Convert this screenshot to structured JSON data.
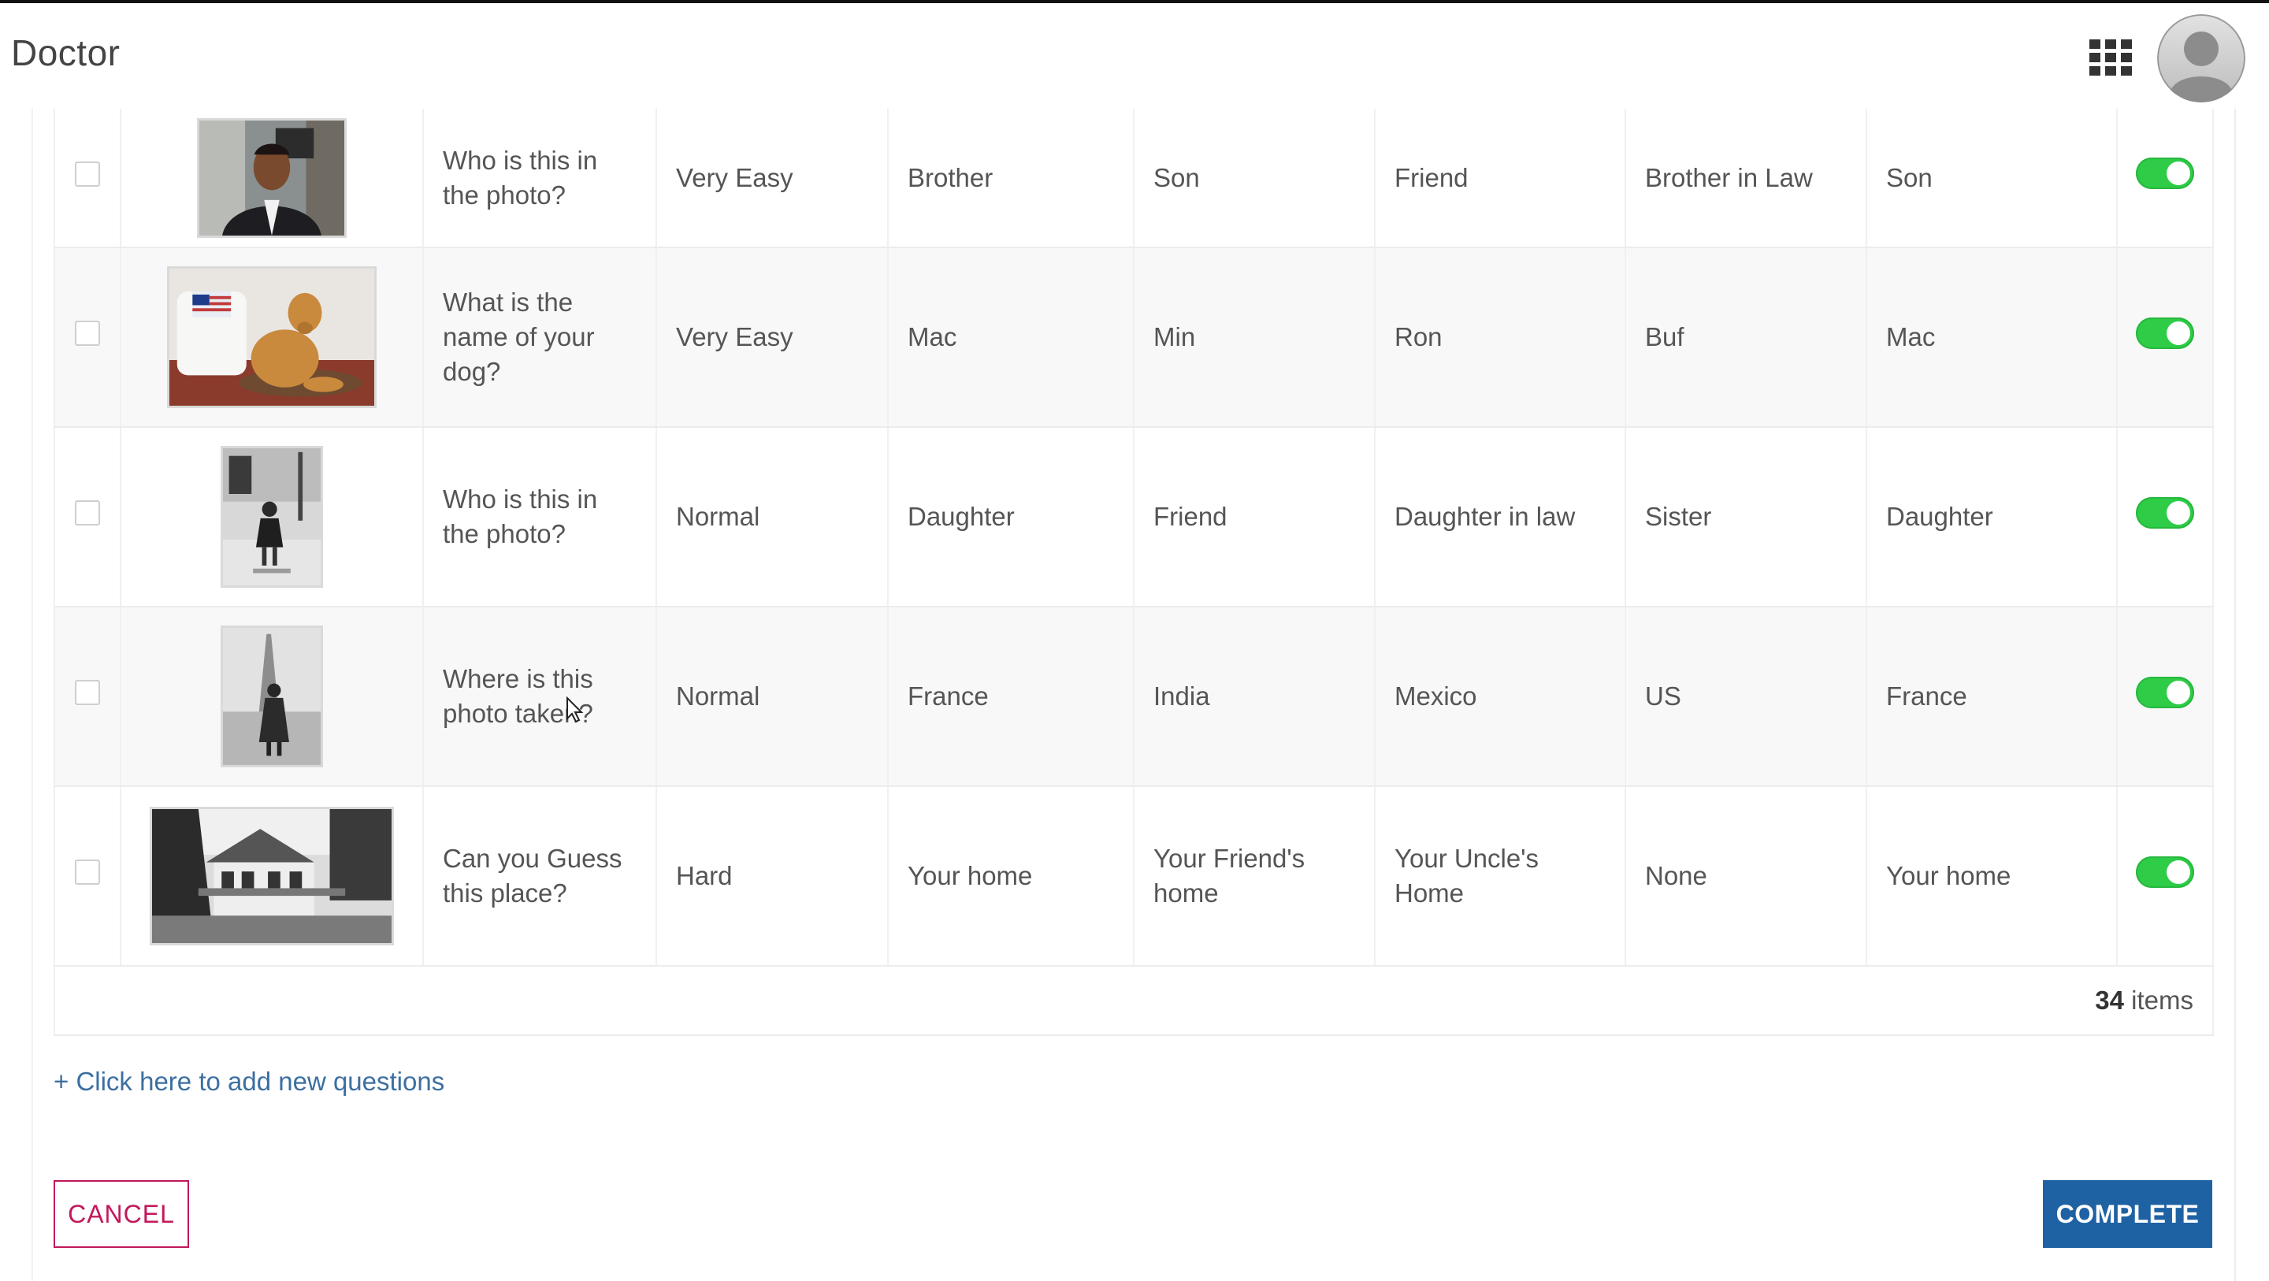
{
  "header": {
    "title": "Doctor",
    "apps_icon": "grid-apps-icon",
    "avatar_icon": "user-avatar-icon"
  },
  "rows": [
    {
      "question": "Who is this in the photo?",
      "difficulty": "Very Easy",
      "option1": "Brother",
      "option2": "Son",
      "option3": "Friend",
      "option4": "Brother in Law",
      "answer": "Son",
      "enabled": true
    },
    {
      "question": "What is the name of your dog?",
      "difficulty": "Very Easy",
      "option1": "Mac",
      "option2": "Min",
      "option3": "Ron",
      "option4": "Buf",
      "answer": "Mac",
      "enabled": true
    },
    {
      "question": "Who is this in the photo?",
      "difficulty": "Normal",
      "option1": "Daughter",
      "option2": "Friend",
      "option3": "Daughter in law",
      "option4": "Sister",
      "answer": "Daughter",
      "enabled": true
    },
    {
      "question": "Where is this photo taken?",
      "difficulty": "Normal",
      "option1": "France",
      "option2": "India",
      "option3": "Mexico",
      "option4": "US",
      "answer": "France",
      "enabled": true
    },
    {
      "question": "Can you Guess this place?",
      "difficulty": "Hard",
      "option1": "Your home",
      "option2": "Your Friend's home",
      "option3": "Your Uncle's Home",
      "option4": "None",
      "answer": "Your home",
      "enabled": true
    }
  ],
  "footer": {
    "count": "34",
    "count_label": " items"
  },
  "add_link": "+ Click here to add new questions",
  "buttons": {
    "cancel": "CANCEL",
    "complete": "COMPLETE"
  },
  "colors": {
    "toggle_on": "#2ecc47",
    "cancel_border": "#c2185b",
    "complete_bg": "#1f62a3",
    "link": "#3c6fa1"
  }
}
